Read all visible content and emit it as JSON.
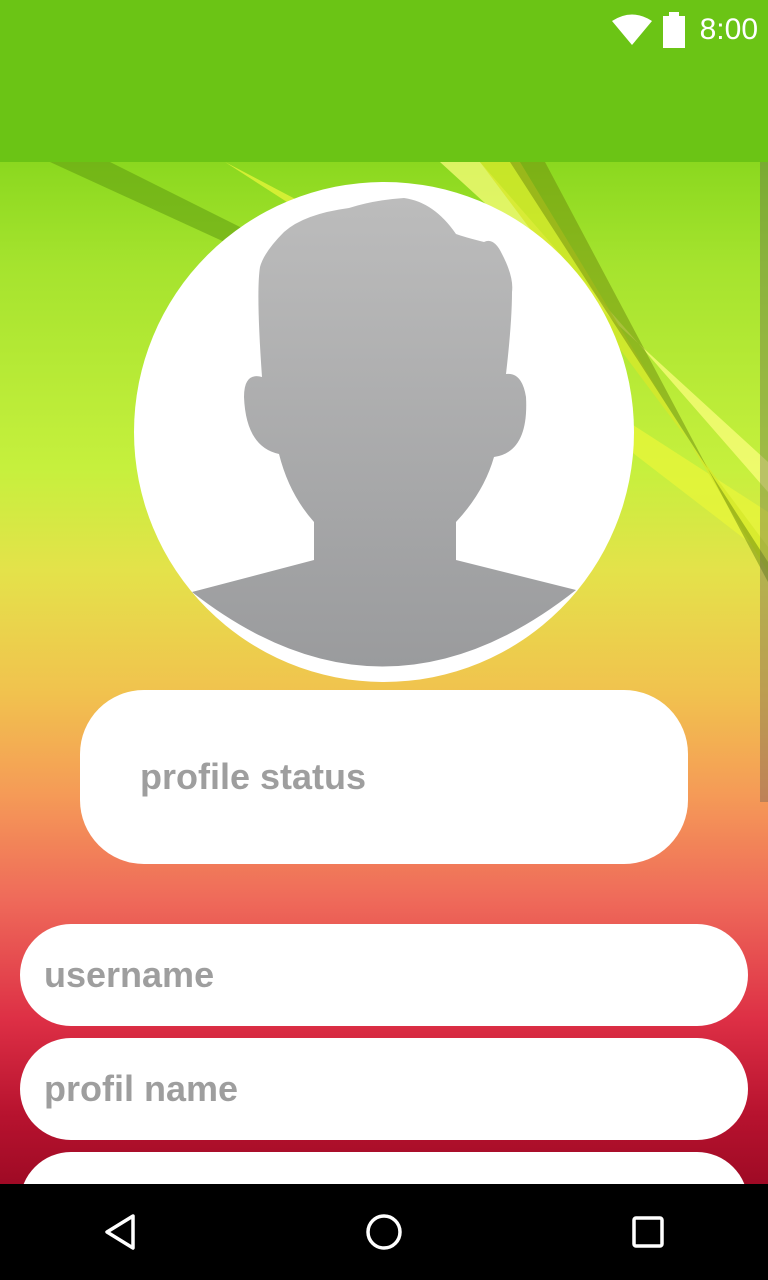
{
  "status_bar": {
    "time": "8:00",
    "icons": [
      "wifi-icon",
      "battery-icon"
    ]
  },
  "colors": {
    "app_bar": "#6bc415",
    "placeholder_text": "#9e9e9e",
    "field_background": "#ffffff"
  },
  "profile": {
    "avatar_icon": "person-silhouette-icon",
    "status_placeholder": "profile status"
  },
  "form": {
    "username_placeholder": "username",
    "profil_name_placeholder": "profil name"
  },
  "navigation": {
    "back_icon": "back-icon",
    "home_icon": "home-icon",
    "recents_icon": "recents-icon"
  }
}
